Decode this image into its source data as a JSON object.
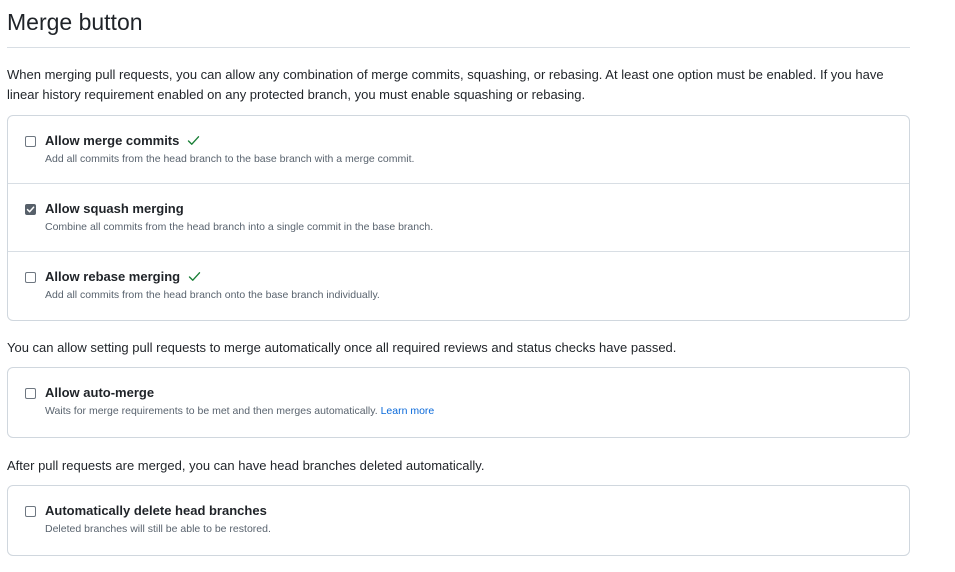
{
  "heading": "Merge button",
  "intro": "When merging pull requests, you can allow any combination of merge commits, squashing, or rebasing. At least one option must be enabled. If you have linear history requirement enabled on any protected branch, you must enable squashing or rebasing.",
  "merge_options": [
    {
      "label": "Allow merge commits",
      "description": "Add all commits from the head branch to the base branch with a merge commit.",
      "checked": false,
      "check_icon": "green-check-icon"
    },
    {
      "label": "Allow squash merging",
      "description": "Combine all commits from the head branch into a single commit in the base branch.",
      "checked": true,
      "check_icon": null
    },
    {
      "label": "Allow rebase merging",
      "description": "Add all commits from the head branch onto the base branch individually.",
      "checked": false,
      "check_icon": "green-check-icon"
    }
  ],
  "auto_merge_intro": "You can allow setting pull requests to merge automatically once all required reviews and status checks have passed.",
  "auto_merge": {
    "label": "Allow auto-merge",
    "description": "Waits for merge requirements to be met and then merges automatically.",
    "link": "Learn more",
    "checked": false
  },
  "delete_intro": "After pull requests are merged, you can have head branches deleted automatically.",
  "delete_branches": {
    "label": "Automatically delete head branches",
    "description": "Deleted branches will still be able to be restored.",
    "checked": false
  },
  "colors": {
    "success_green": "#1a7f37",
    "link_blue": "#0969da",
    "border": "#d0d7de"
  }
}
